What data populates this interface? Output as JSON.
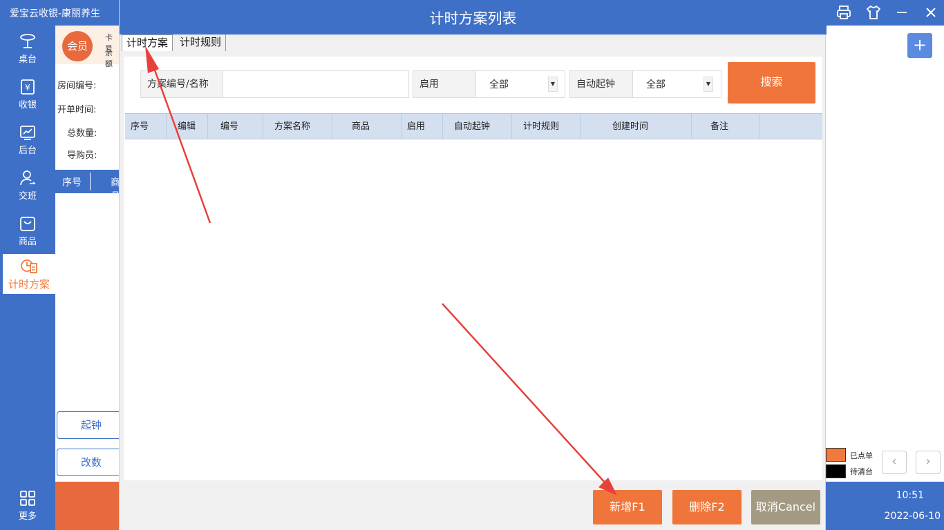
{
  "app": {
    "title": "爱宝云收银-康丽养生",
    "nav": [
      {
        "label": "桌台",
        "icon": "table-icon"
      },
      {
        "label": "收银",
        "icon": "cashier-icon"
      },
      {
        "label": "后台",
        "icon": "chart-icon"
      },
      {
        "label": "交班",
        "icon": "handover-icon"
      },
      {
        "label": "商品",
        "icon": "bag-icon"
      },
      {
        "label": "计时方案",
        "icon": "timer-plan-icon",
        "active": true
      },
      {
        "label": "更多",
        "icon": "grid-icon"
      }
    ],
    "member": {
      "avatar_label": "会员",
      "card_label": "卡号",
      "balance_label": "余额"
    },
    "info_labels": {
      "room": "房间编号:",
      "open_time": "开单时间:",
      "total": "总数量:",
      "guide": "导购员:"
    },
    "order_table": {
      "col1": "序号",
      "col2": "商品"
    },
    "buttons": {
      "start_clock": "起钟",
      "change_qty": "改数"
    },
    "legend": [
      {
        "label": "已点单",
        "color": "#f07a3c"
      },
      {
        "label": "待清台",
        "color": "#000000"
      }
    ],
    "clock": "10:51",
    "date": "2022-06-10",
    "pager": {
      "prev": "‹",
      "next": "›"
    },
    "add_label": "+"
  },
  "dialog": {
    "title": "计时方案列表",
    "tabs": [
      "计时方案",
      "计时规则"
    ],
    "filters": {
      "code_name_label": "方案编号/名称",
      "code_name_value": "",
      "enabled_label": "启用",
      "enabled_value": "全部",
      "auto_start_label": "自动起钟",
      "auto_start_value": "全部",
      "search_label": "搜索"
    },
    "columns": [
      "序号",
      "编辑",
      "编号",
      "方案名称",
      "商品",
      "启用",
      "自动起钟",
      "计时规则",
      "创建时间",
      "备注"
    ],
    "rows": [],
    "footer": {
      "add_label": "新增F1",
      "delete_label": "删除F2",
      "cancel_label": "取消Cancel"
    }
  },
  "colors": {
    "primary": "#3f70c8",
    "accent": "#f0753a",
    "cancel": "#a39a84",
    "annotation": "#e8403a"
  }
}
